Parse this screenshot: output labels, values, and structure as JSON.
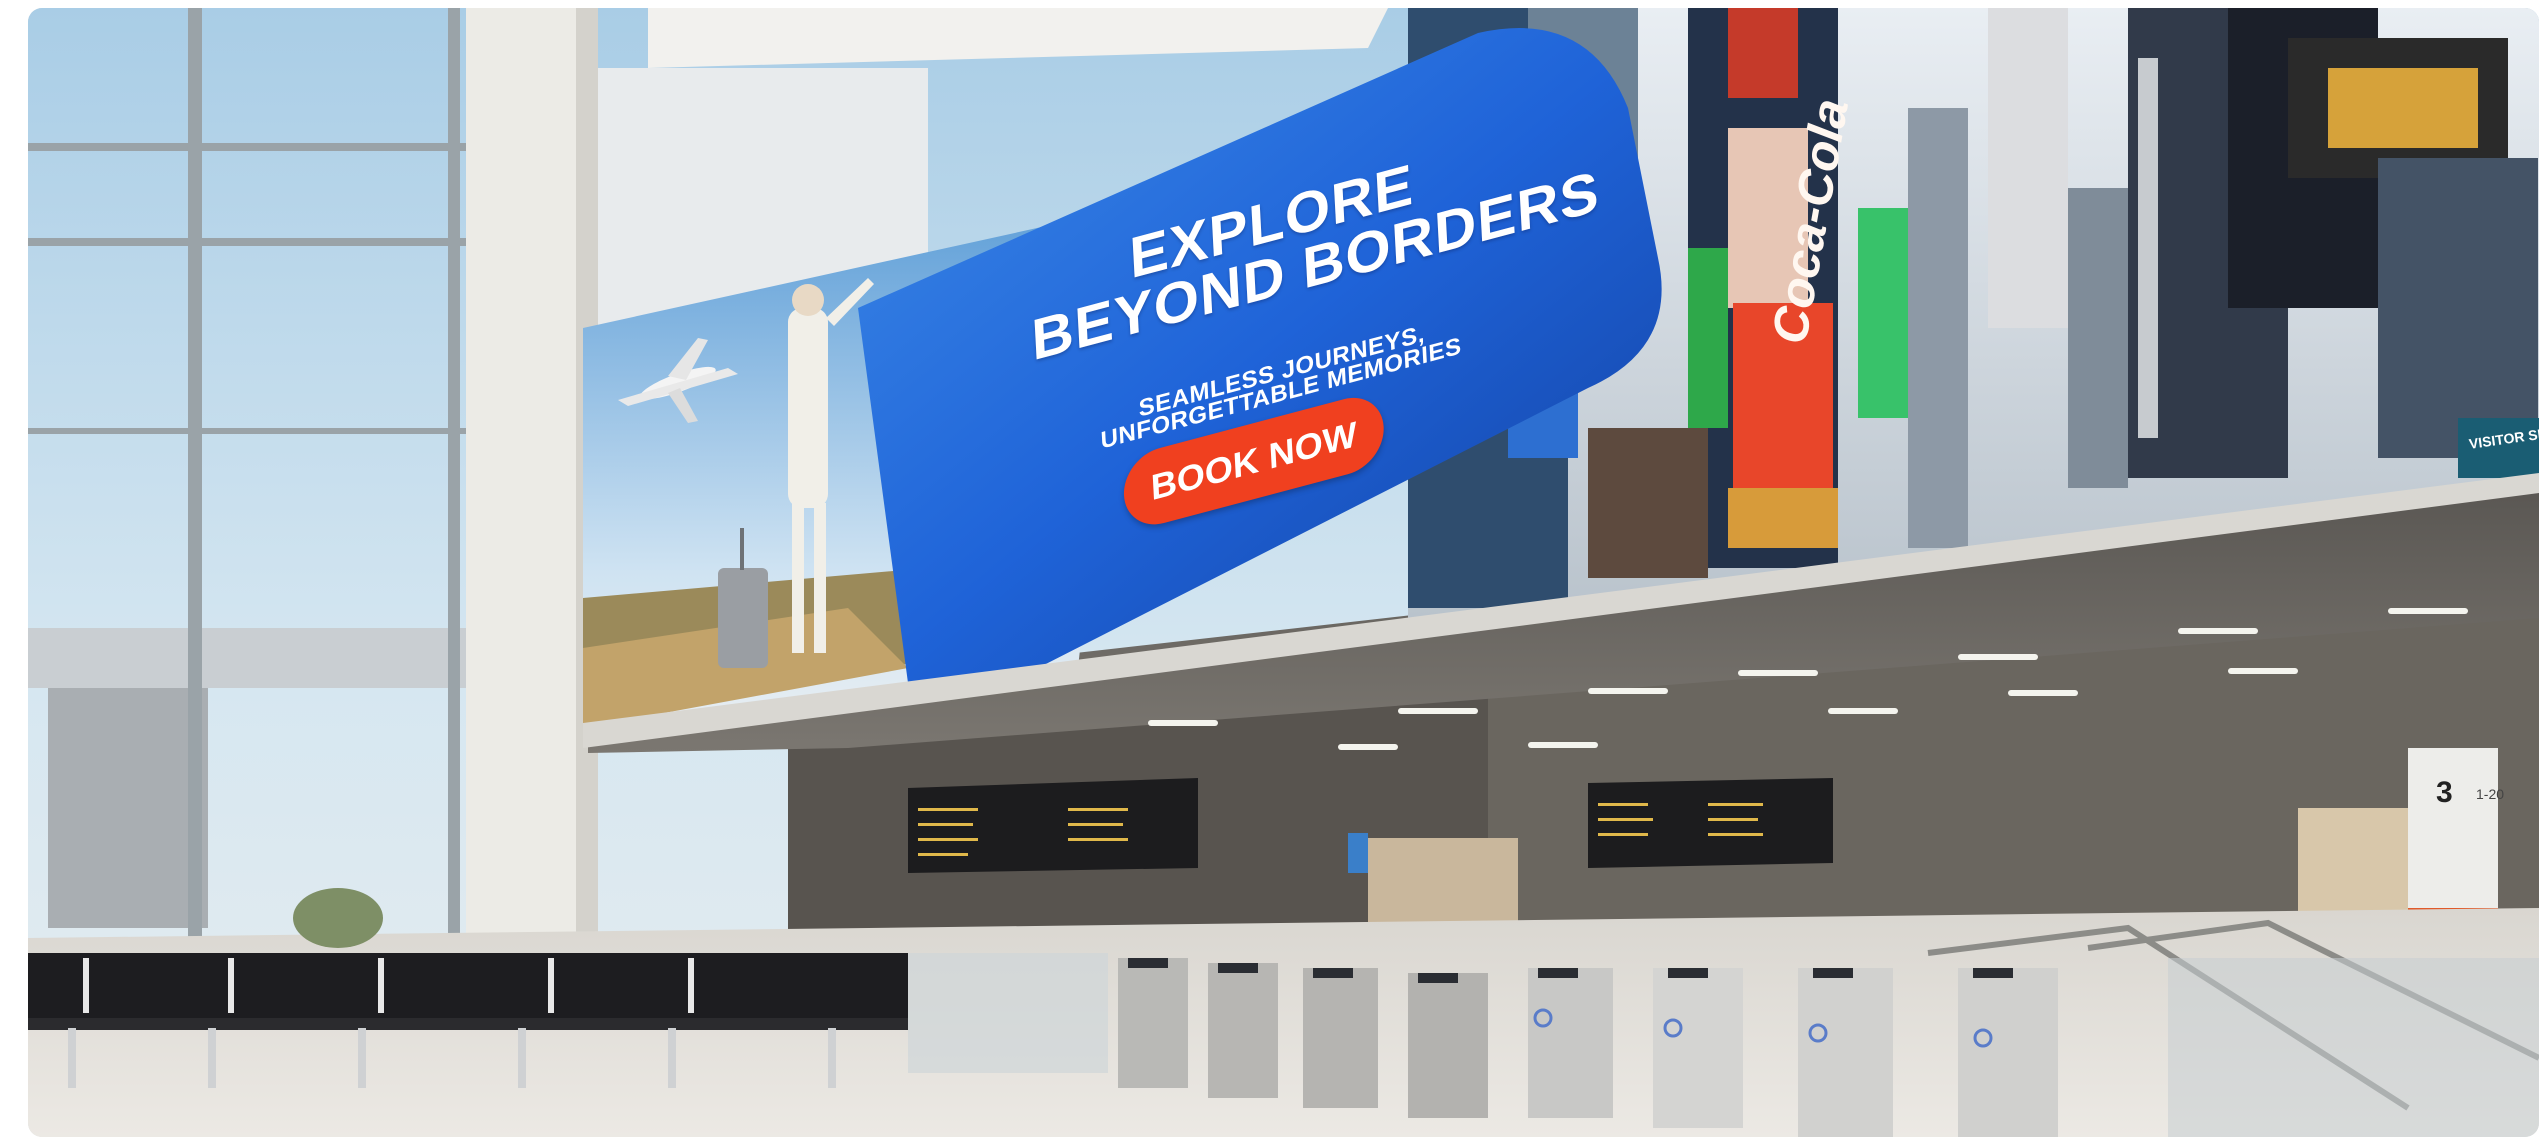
{
  "ad": {
    "headline_line1": "EXPLORE",
    "headline_line2": "BEYOND BORDERS",
    "subline_1": "SEAMLESS JOURNEYS,",
    "subline_2": "UNFORGETTABLE MEMORIES",
    "cta_label": "BOOK NOW"
  },
  "city_screen": {
    "brand": "Coca-Cola",
    "visitor_sign": "VISITOR SERVICES"
  },
  "signage": {
    "number": "3",
    "detail": "1-20"
  },
  "colors": {
    "ad_blue": "#1e5ed6",
    "cta_orange": "#f0401f",
    "sky": "#bcd8ea"
  }
}
